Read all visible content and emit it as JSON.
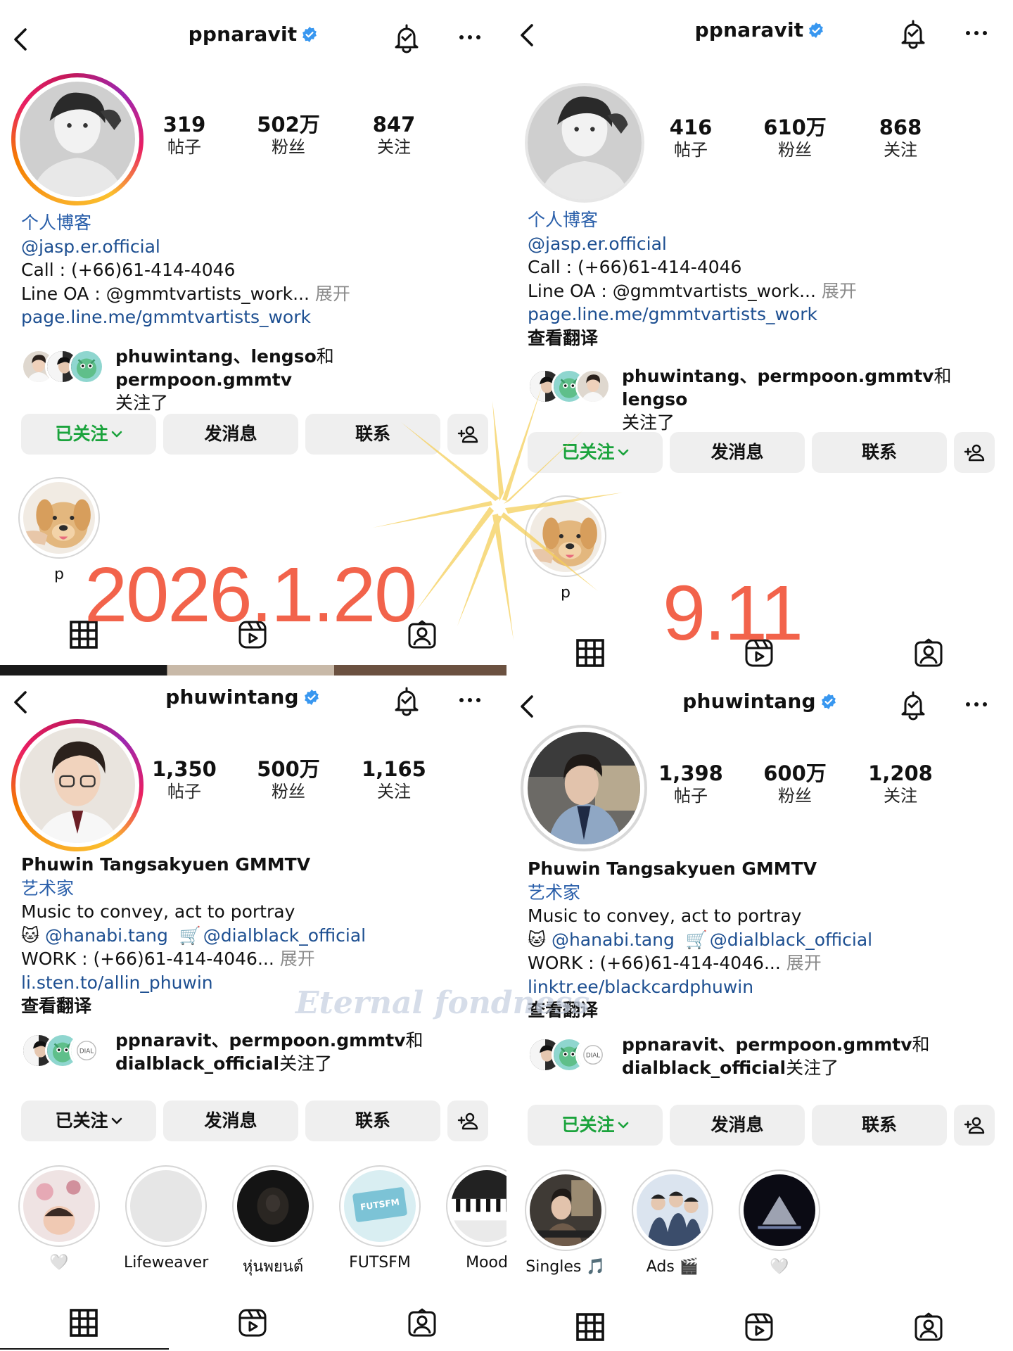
{
  "panels": [
    {
      "username": "ppnaravit",
      "stats": [
        {
          "num": "319",
          "label": "帖子"
        },
        {
          "num": "502万",
          "label": "粉丝"
        },
        {
          "num": "847",
          "label": "关注"
        }
      ],
      "bio": {
        "category": "个人博客",
        "handle": "@jasp.er.official",
        "call": "Call : (+66)61-414-4046",
        "line_oa": "Line OA : @gmmtvartists_work...",
        "expand": "展开",
        "link": "page.line.me/gmmtvartists_work"
      },
      "followed_by": {
        "names": "phuwintang、lengso",
        "and": "和",
        "last": "permpoon.gmmtv",
        "suffix": "关注了"
      },
      "buttons": {
        "following": "已关注",
        "message": "发消息",
        "contact": "联系"
      },
      "highlights": [
        {
          "caption": "p"
        }
      ],
      "overlay_date": "2026.1.20"
    },
    {
      "username": "ppnaravit",
      "stats": [
        {
          "num": "416",
          "label": "帖子"
        },
        {
          "num": "610万",
          "label": "粉丝"
        },
        {
          "num": "868",
          "label": "关注"
        }
      ],
      "bio": {
        "category": "个人博客",
        "handle": "@jasp.er.official",
        "call": "Call : (+66)61-414-4046",
        "line_oa": "Line OA : @gmmtvartists_work...",
        "expand": "展开",
        "link": "page.line.me/gmmtvartists_work",
        "translate": "查看翻译"
      },
      "followed_by": {
        "names": "phuwintang、permpoon.gmmtv",
        "and": "和",
        "last": "lengso",
        "suffix": "关注了"
      },
      "buttons": {
        "following": "已关注",
        "message": "发消息",
        "contact": "联系"
      },
      "highlights": [
        {
          "caption": "p"
        }
      ],
      "overlay_date": "9.11"
    },
    {
      "username": "phuwintang",
      "stats": [
        {
          "num": "1,350",
          "label": "帖子"
        },
        {
          "num": "500万",
          "label": "粉丝"
        },
        {
          "num": "1,165",
          "label": "关注"
        }
      ],
      "bio": {
        "name": "Phuwin Tangsakyuen GMMTV",
        "category": "艺术家",
        "tagline": "Music to convey, act to portray",
        "handle1": "@hanabi.tang",
        "handle2": "@dialblack_official",
        "work": "WORK : (+66)61-414-4046...",
        "expand": "展开",
        "link": "li.sten.to/allin_phuwin",
        "translate": "查看翻译"
      },
      "followed_by": {
        "names": "ppnaravit、permpoon.gmmtv",
        "and": "和",
        "last": "dialblack_official",
        "suffix": "关注了"
      },
      "buttons": {
        "following": "已关注",
        "message": "发消息",
        "contact": "联系"
      },
      "highlights": [
        {
          "caption": "🤍"
        },
        {
          "caption": "Lifeweaver"
        },
        {
          "caption": "หุ่นพยนต์"
        },
        {
          "caption": "FUTSFM"
        },
        {
          "caption": "Mood"
        }
      ]
    },
    {
      "username": "phuwintang",
      "stats": [
        {
          "num": "1,398",
          "label": "帖子"
        },
        {
          "num": "600万",
          "label": "粉丝"
        },
        {
          "num": "1,208",
          "label": "关注"
        }
      ],
      "bio": {
        "name": "Phuwin Tangsakyuen GMMTV",
        "category": "艺术家",
        "tagline": "Music to convey, act to portray",
        "handle1": "@hanabi.tang",
        "handle2": "@dialblack_official",
        "work": "WORK : (+66)61-414-4046...",
        "expand": "展开",
        "link": "linktr.ee/blackcardphuwin",
        "translate": "查看翻译"
      },
      "followed_by": {
        "names": "ppnaravit、permpoon.gmmtv",
        "and": "和",
        "last": "dialblack_official",
        "suffix": "关注了"
      },
      "buttons": {
        "following": "已关注",
        "message": "发消息",
        "contact": "联系"
      },
      "highlights": [
        {
          "caption": "Singles 🎵"
        },
        {
          "caption": "Ads 🎬"
        },
        {
          "caption": "🤍"
        }
      ]
    }
  ],
  "watermark": "Eternal fondness",
  "colors": {
    "accent_green": "#1aa33c",
    "link_blue": "#1d4f91",
    "date_red": "#f2583e",
    "verified_blue": "#3897f0"
  },
  "icons": [
    "back-icon",
    "verified-icon",
    "bell-icon",
    "more-icon",
    "add-person-icon",
    "grid-icon",
    "reels-icon",
    "tagged-icon"
  ]
}
